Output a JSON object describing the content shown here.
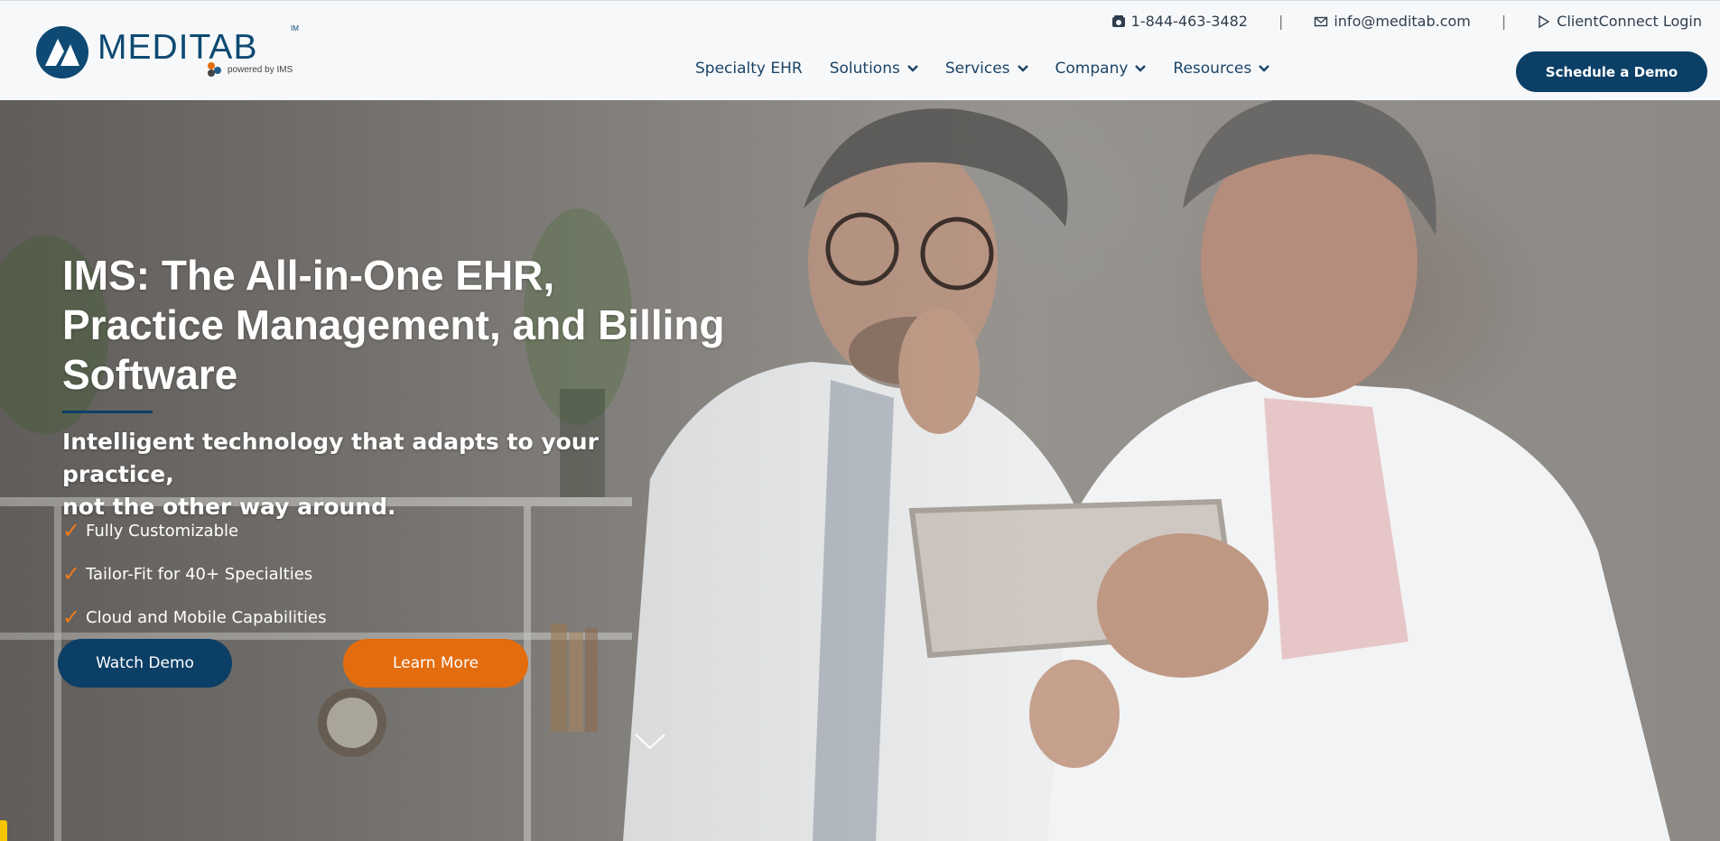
{
  "brand": {
    "name": "MEDITAB",
    "tm": "IM",
    "powered_by": "powered by IMS",
    "colors": {
      "navy": "#0c3f66",
      "orange": "#e36c0e"
    }
  },
  "topbar": {
    "phone": "1-844-463-3482",
    "email": "info@meditab.com",
    "login": "ClientConnect Login"
  },
  "nav": {
    "items": [
      {
        "label": "Specialty EHR",
        "dropdown": false
      },
      {
        "label": "Solutions",
        "dropdown": true
      },
      {
        "label": "Services",
        "dropdown": true
      },
      {
        "label": "Company",
        "dropdown": true
      },
      {
        "label": "Resources",
        "dropdown": true
      }
    ],
    "cta": "Schedule a Demo"
  },
  "hero": {
    "title_lines": [
      "IMS: The All-in-One EHR,",
      "Practice Management, and Billing",
      "Software"
    ],
    "subtitle_lines": [
      "Intelligent technology that adapts to your practice,",
      "not the other way around."
    ],
    "features": [
      "Fully Customizable",
      "Tailor-Fit for 40+ Specialties",
      "Cloud and Mobile Capabilities"
    ],
    "buttons": {
      "watch": "Watch Demo",
      "learn": "Learn More"
    },
    "icons": {
      "feature": "check-icon",
      "scroll": "chevron-down-icon"
    }
  }
}
